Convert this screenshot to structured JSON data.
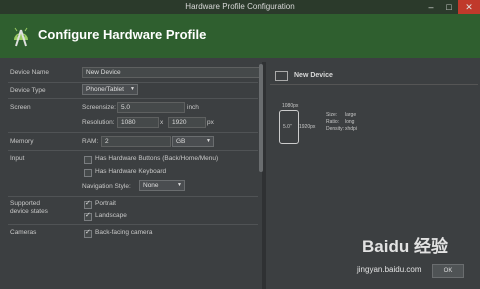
{
  "window": {
    "title": "Hardware Profile Configuration",
    "minimize_icon": "minimize-icon",
    "maximize_icon": "maximize-icon",
    "close_icon": "close-icon"
  },
  "banner": {
    "title": "Configure Hardware Profile",
    "logo_icon": "android-studio-logo-icon",
    "color": "#2f5f2f"
  },
  "form": {
    "device_name": {
      "label": "Device Name",
      "value": "New Device"
    },
    "device_type": {
      "label": "Device Type",
      "value": "Phone/Tablet"
    },
    "screen": {
      "label": "Screen",
      "screensize_label": "Screensize:",
      "screensize_value": "5.0",
      "screensize_unit": "inch",
      "resolution_label": "Resolution:",
      "res_width": "1080",
      "res_x": "x",
      "res_height": "1920",
      "res_unit": "px"
    },
    "memory": {
      "label": "Memory",
      "ram_label": "RAM:",
      "ram_value": "2",
      "ram_unit": "GB"
    },
    "input": {
      "label": "Input",
      "hw_buttons": "Has Hardware Buttons (Back/Home/Menu)",
      "hw_keyboard": "Has Hardware Keyboard",
      "nav_style_label": "Navigation Style:",
      "nav_style_value": "None"
    },
    "supported_states": {
      "label_line1": "Supported",
      "label_line2": "device states",
      "portrait": "Portrait",
      "landscape": "Landscape"
    },
    "cameras": {
      "label": "Cameras",
      "back_camera": "Back-facing camera"
    }
  },
  "preview": {
    "title": "New Device",
    "width_px": "1080px",
    "height_px": "1920px",
    "diagonal": "5.0\"",
    "size_label": "Size:",
    "size_value": "large",
    "ratio_label": "Ratio:",
    "ratio_value": "long",
    "density_label": "Density:",
    "density_value": "xhdpi"
  },
  "watermark": {
    "line1": "Baidu 经验",
    "line2": "jingyan.baidu.com"
  },
  "footer": {
    "button_label": "OK"
  }
}
